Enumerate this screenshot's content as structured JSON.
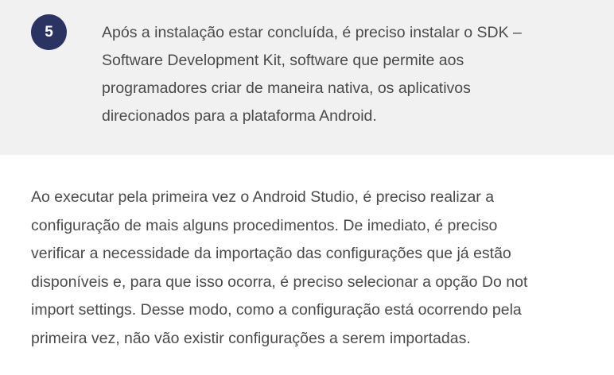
{
  "step": {
    "number": "5",
    "lines": [
      "Após a instalação estar concluída, é preciso instalar o SDK –",
      "Software Development Kit, software que permite aos",
      "programadores criar de maneira nativa, os aplicativos",
      "direcionados para a plataforma Android."
    ]
  },
  "paragraph": {
    "lines": [
      "Ao executar pela primeira vez o Android Studio, é preciso realizar a",
      "configuração de mais alguns procedimentos. De imediato, é preciso",
      "verificar a necessidade da importação das configurações que já estão",
      "disponíveis e, para que isso ocorra, é preciso selecionar a opção Do not",
      "import settings. Desse modo, como a configuração está ocorrendo pela",
      "primeira vez, não vão existir configurações a serem importadas."
    ]
  },
  "colors": {
    "badge_background": "#2b3362",
    "step_box_background": "#f1f1f1",
    "text": "#4a4a4a"
  }
}
